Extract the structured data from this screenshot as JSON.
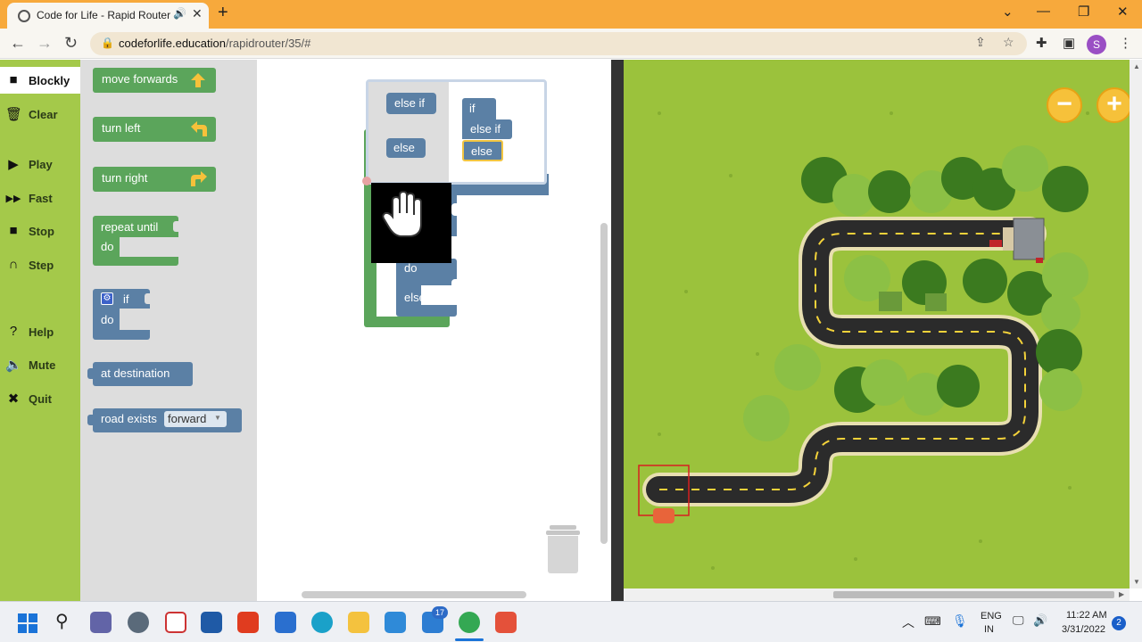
{
  "browser": {
    "tab_title": "Code for Life - Rapid Router",
    "tab_audio_icon": "speaker-icon",
    "new_tab": "+",
    "url_domain": "codeforlife.education",
    "url_path": "/rapidrouter/35/#",
    "profile_initial": "S",
    "window_controls": [
      "⌄",
      "—",
      "❐",
      "✕"
    ]
  },
  "menu": {
    "items": [
      {
        "label": "Blockly",
        "icon": "blockly-icon"
      },
      {
        "label": "Clear",
        "icon": "trash-icon"
      },
      {
        "label": "Play",
        "icon": "play-icon"
      },
      {
        "label": "Fast",
        "icon": "fast-forward-icon"
      },
      {
        "label": "Stop",
        "icon": "stop-icon"
      },
      {
        "label": "Step",
        "icon": "step-icon"
      },
      {
        "label": "Help",
        "icon": "help-icon"
      },
      {
        "label": "Mute",
        "icon": "speaker-icon"
      },
      {
        "label": "Quit",
        "icon": "close-icon"
      }
    ]
  },
  "toolbox": {
    "move_forwards": "move forwards",
    "turn_left": "turn left",
    "turn_right": "turn right",
    "repeat_until": "repeat until",
    "repeat_do": "do",
    "if": "if",
    "if_do": "do",
    "at_destination": "at destination",
    "road_exists": "road exists",
    "road_exists_option": "forward"
  },
  "workspace": {
    "mutator": {
      "left": [
        "else if",
        "else"
      ],
      "right": [
        "if",
        "else if",
        "else"
      ]
    },
    "if_block": {
      "do": "do",
      "else": "else"
    }
  },
  "taskbar": {
    "lang_top": "ENG",
    "lang_bottom": "IN",
    "time": "11:22 AM",
    "date": "3/31/2022",
    "notifications": "2",
    "mail_badge": "17"
  }
}
